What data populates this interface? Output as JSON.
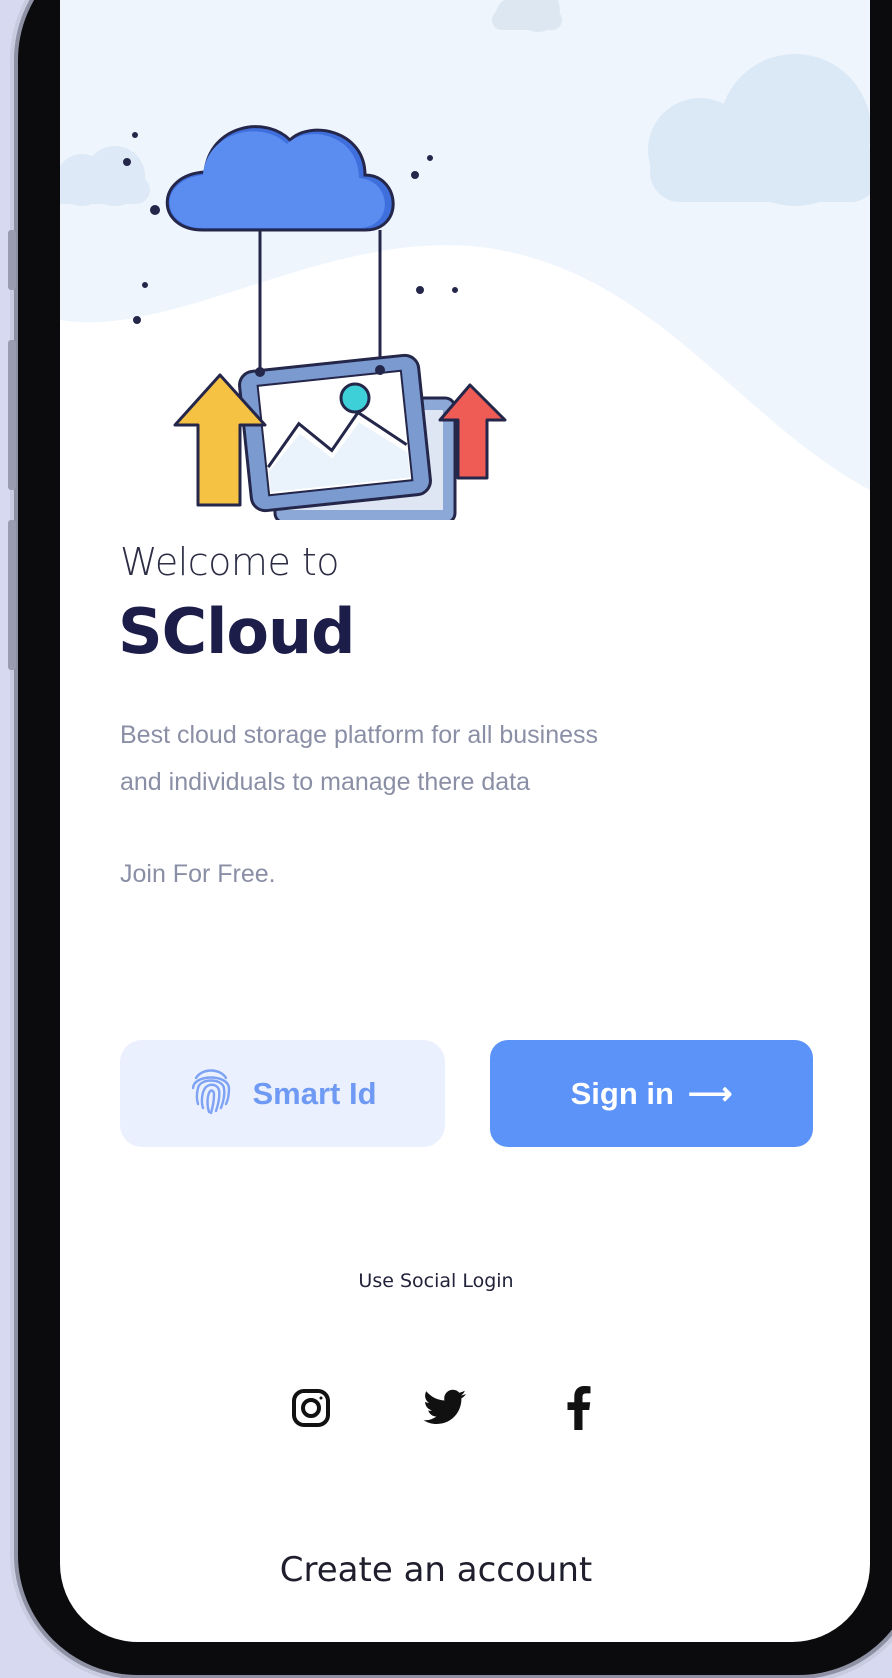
{
  "welcome": {
    "line1": "Welcome to",
    "brand": "SCloud"
  },
  "description": "Best cloud storage platform for all business and individuals to manage there data",
  "join_text": "Join For Free.",
  "buttons": {
    "smart_id": "Smart Id",
    "sign_in": "Sign in",
    "sign_in_arrow": "⟶"
  },
  "social": {
    "title": "Use Social Login",
    "icons": [
      "instagram-icon",
      "twitter-icon",
      "facebook-icon"
    ]
  },
  "create_account": "Create an account",
  "colors": {
    "primary": "#5b93f8",
    "primary_soft": "#eaf0fd",
    "heading": "#1d1d4a",
    "muted": "#8a8fa6"
  }
}
